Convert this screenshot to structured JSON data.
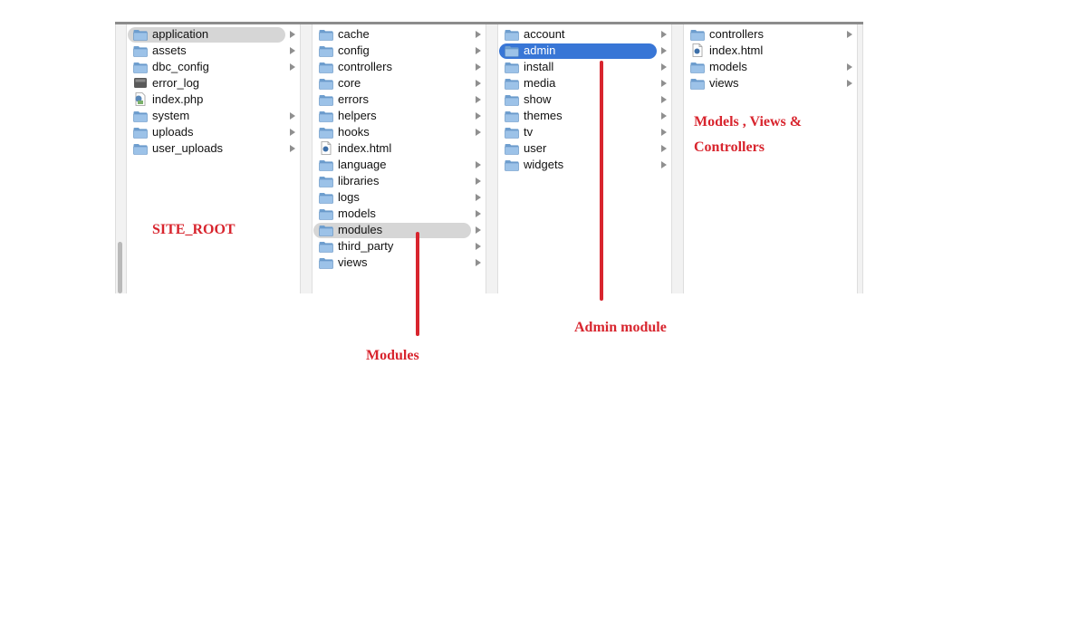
{
  "columns": [
    {
      "id": "site-root",
      "items": [
        {
          "label": "application",
          "kind": "folder",
          "chevron": true,
          "selected": "gray"
        },
        {
          "label": "assets",
          "kind": "folder",
          "chevron": true
        },
        {
          "label": "dbc_config",
          "kind": "folder",
          "chevron": true
        },
        {
          "label": "error_log",
          "kind": "log"
        },
        {
          "label": "index.php",
          "kind": "php"
        },
        {
          "label": "system",
          "kind": "folder",
          "chevron": true
        },
        {
          "label": "uploads",
          "kind": "folder",
          "chevron": true
        },
        {
          "label": "user_uploads",
          "kind": "folder",
          "chevron": true
        }
      ]
    },
    {
      "id": "application",
      "items": [
        {
          "label": "cache",
          "kind": "folder",
          "chevron": true
        },
        {
          "label": "config",
          "kind": "folder",
          "chevron": true
        },
        {
          "label": "controllers",
          "kind": "folder",
          "chevron": true
        },
        {
          "label": "core",
          "kind": "folder",
          "chevron": true
        },
        {
          "label": "errors",
          "kind": "folder",
          "chevron": true
        },
        {
          "label": "helpers",
          "kind": "folder",
          "chevron": true
        },
        {
          "label": "hooks",
          "kind": "folder",
          "chevron": true
        },
        {
          "label": "index.html",
          "kind": "html"
        },
        {
          "label": "language",
          "kind": "folder",
          "chevron": true
        },
        {
          "label": "libraries",
          "kind": "folder",
          "chevron": true
        },
        {
          "label": "logs",
          "kind": "folder",
          "chevron": true
        },
        {
          "label": "models",
          "kind": "folder",
          "chevron": true
        },
        {
          "label": "modules",
          "kind": "folder",
          "chevron": true,
          "selected": "gray"
        },
        {
          "label": "third_party",
          "kind": "folder",
          "chevron": true
        },
        {
          "label": "views",
          "kind": "folder",
          "chevron": true
        }
      ]
    },
    {
      "id": "modules",
      "items": [
        {
          "label": "account",
          "kind": "folder",
          "chevron": true
        },
        {
          "label": "admin",
          "kind": "folder",
          "chevron": true,
          "selected": "blue"
        },
        {
          "label": "install",
          "kind": "folder",
          "chevron": true
        },
        {
          "label": "media",
          "kind": "folder",
          "chevron": true
        },
        {
          "label": "show",
          "kind": "folder",
          "chevron": true
        },
        {
          "label": "themes",
          "kind": "folder",
          "chevron": true
        },
        {
          "label": "tv",
          "kind": "folder",
          "chevron": true
        },
        {
          "label": "user",
          "kind": "folder",
          "chevron": true
        },
        {
          "label": "widgets",
          "kind": "folder",
          "chevron": true
        }
      ]
    },
    {
      "id": "admin",
      "items": [
        {
          "label": "controllers",
          "kind": "folder",
          "chevron": true
        },
        {
          "label": "index.html",
          "kind": "html"
        },
        {
          "label": "models",
          "kind": "folder",
          "chevron": true
        },
        {
          "label": "views",
          "kind": "folder",
          "chevron": true
        }
      ]
    }
  ],
  "annotations": {
    "site_root": "SITE_ROOT",
    "modules": "Modules",
    "admin_module": "Admin module",
    "mvc_line1": "Models , Views &",
    "mvc_line2": "Controllers"
  },
  "colors": {
    "annotation_red": "#d8252e",
    "selection_blue": "#3876d6",
    "selection_gray": "#d6d6d6",
    "folder_blue": "#9cc2e8"
  }
}
